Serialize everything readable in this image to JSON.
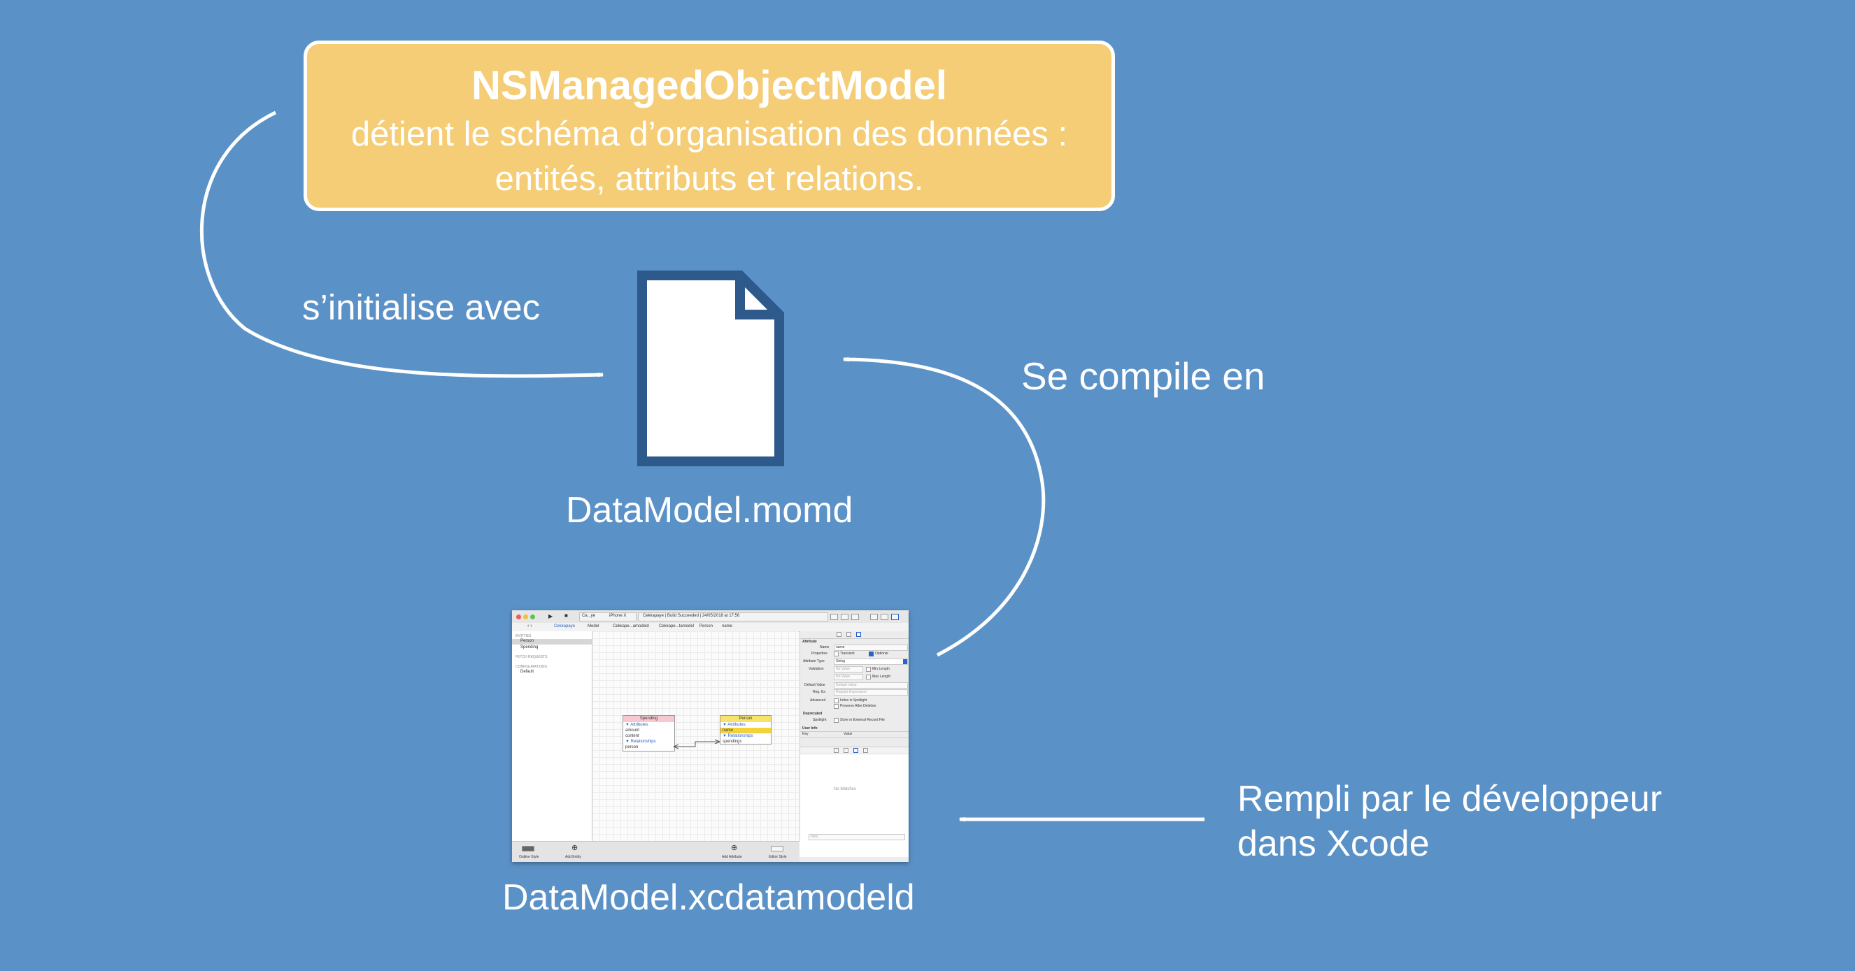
{
  "model": {
    "title": "NSManagedObjectModel",
    "desc_line1": "détient le schéma d’organisation des données :",
    "desc_line2": "entités, attributs et relations."
  },
  "labels": {
    "initialise": "s’initialise avec",
    "compile": "Se compile en",
    "rempli_line1": "Rempli par le développeur",
    "rempli_line2": "dans Xcode",
    "momd": "DataModel.momd",
    "xcdatamodeld": "DataModel.xcdatamodeld"
  },
  "colors": {
    "background": "#5a91c7",
    "box_fill": "#f4cd76",
    "document_stroke": "#2d5a8a",
    "white": "#ffffff"
  },
  "xcode": {
    "breadcrumb": [
      "Ca...ye",
      "iPhone X",
      "Cekkapaye",
      "Model",
      "Cekkape...amodeld",
      "Cekkape...tamodel",
      "Person",
      "name"
    ],
    "status": "Cekkapaye | Build Succeeded | 24/05/2018 at 17:56",
    "sidebar": {
      "entities_header": "ENTITIES",
      "entities": [
        "Person",
        "Spending"
      ],
      "fetch_header": "FETCH REQUESTS",
      "config_header": "CONFIGURATIONS",
      "configs": [
        "Default"
      ]
    },
    "spending": {
      "name": "Spending",
      "attributes_header": "▼ Attributes",
      "attributes": [
        "amount",
        "content"
      ],
      "relationships_header": "▼ Relationships",
      "relationships": [
        "person"
      ]
    },
    "person": {
      "name": "Person",
      "attributes_header": "▼ Attributes",
      "attributes": [
        "name"
      ],
      "relationships_header": "▼ Relationships",
      "relationships": [
        "spendings"
      ]
    },
    "inspector": {
      "section": "Attribute",
      "name_label": "Name",
      "name_value": "name",
      "properties_label": "Properties",
      "transient": "Transient",
      "optional": "Optional",
      "type_label": "Attribute Type",
      "type_value": "String",
      "validation_label": "Validation",
      "no_value_1": "No Value",
      "no_value_2": "No Value",
      "min_length": "Min Length",
      "max_length": "Max Length",
      "default_label": "Default Value",
      "default_ph": "Default Value",
      "regex_label": "Reg. Ex.",
      "regex_ph": "Regular Expression",
      "advanced_label": "Advanced",
      "index_spotlight": "Index in Spotlight",
      "preserve_deletion": "Preserve After Deletion",
      "deprecated_label": "Deprecated",
      "spotlight_label": "Spotlight",
      "store_external": "Store in External Record File",
      "user_info": "User Info",
      "key": "Key",
      "value": "Value",
      "no_matches": "No Matches",
      "filter": "Filter"
    },
    "bottom": {
      "outline_style": "Outline Style",
      "add_entity": "Add Entity",
      "add_attribute": "Add Attribute",
      "editor_style": "Editor Style"
    }
  }
}
